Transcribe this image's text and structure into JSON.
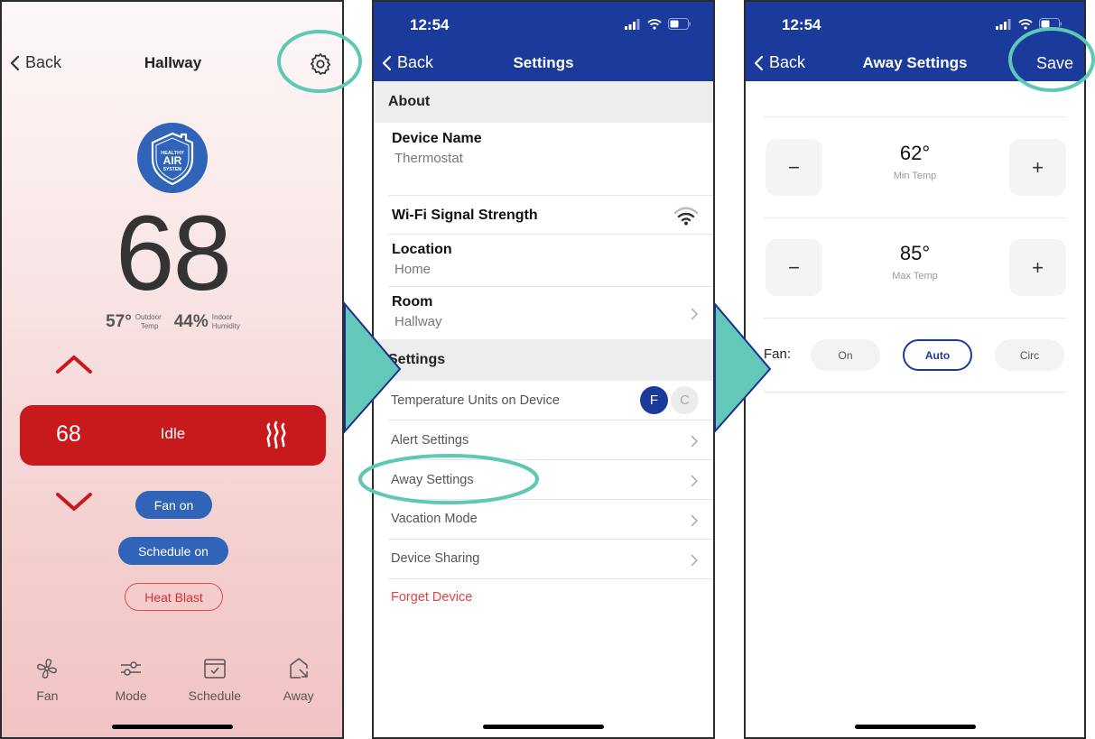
{
  "screens": {
    "thermostat": {
      "back_label": "Back",
      "title": "Hallway",
      "logo": {
        "line1": "HEALTHY",
        "line2": "AIR",
        "line3": "SYSTEM"
      },
      "current_temp": "68",
      "outdoor": {
        "value": "57°",
        "label_line1": "Outdoor",
        "label_line2": "Temp"
      },
      "humidity": {
        "value": "44%",
        "label_line1": "Indoor",
        "label_line2": "Humidity"
      },
      "setpoint_bar": {
        "setpoint": "68",
        "status": "Idle",
        "mode_icon": "heat-icon"
      },
      "pills": {
        "fan": "Fan on",
        "schedule": "Schedule on",
        "heat_blast": "Heat Blast"
      },
      "tabs": [
        {
          "label": "Fan",
          "icon": "fan-icon"
        },
        {
          "label": "Mode",
          "icon": "sliders-icon"
        },
        {
          "label": "Schedule",
          "icon": "calendar-check-icon"
        },
        {
          "label": "Away",
          "icon": "away-house-icon"
        }
      ],
      "colors": {
        "accent_red": "#c8191c",
        "pill_blue": "#2f64b8"
      }
    },
    "settings": {
      "time": "12:54",
      "back_label": "Back",
      "title": "Settings",
      "about_header": "About",
      "device_name": {
        "title": "Device Name",
        "value": "Thermostat"
      },
      "wifi": {
        "title": "Wi-Fi Signal Strength",
        "icon": "wifi-icon"
      },
      "location": {
        "title": "Location",
        "value": "Home"
      },
      "room": {
        "title": "Room",
        "value": "Hallway"
      },
      "settings_header": "Settings",
      "temp_units": {
        "label": "Temperature Units on Device",
        "options": [
          "F",
          "C"
        ],
        "selected": "F"
      },
      "items": [
        "Alert Settings",
        "Away Settings",
        "Vacation Mode",
        "Device Sharing"
      ],
      "forget_device": "Forget Device",
      "colors": {
        "header_blue": "#1a3a9c",
        "danger": "#e04444"
      }
    },
    "away_settings": {
      "time": "12:54",
      "back_label": "Back",
      "title": "Away Settings",
      "save_label": "Save",
      "min_temp": {
        "value": "62°",
        "label": "Min Temp",
        "minus": "−",
        "plus": "+"
      },
      "max_temp": {
        "value": "85°",
        "label": "Max Temp",
        "minus": "−",
        "plus": "+"
      },
      "fan": {
        "label": "Fan:",
        "options": [
          "On",
          "Auto",
          "Circ"
        ],
        "selected": "Auto"
      }
    }
  },
  "annotations": {
    "highlight_color": "#5ec8b5",
    "arrow_fill": "#63c8b8",
    "arrow_stroke": "#1a2f8f"
  }
}
